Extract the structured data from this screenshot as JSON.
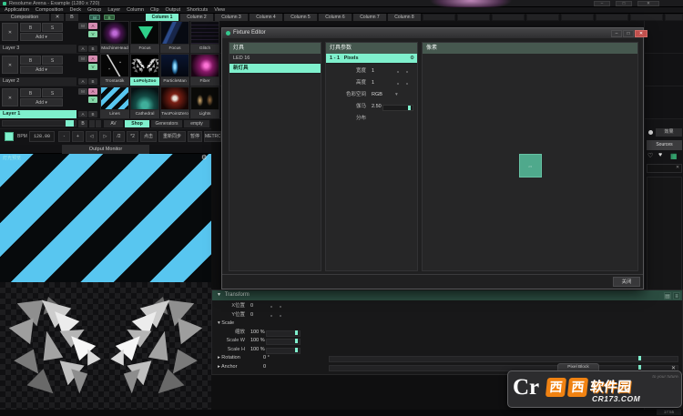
{
  "icons": {
    "caret_down": "▾",
    "arrow_right": "▸",
    "arrow_down": "▾",
    "gear": "⚙",
    "heart": "♥",
    "heart_outline": "♡",
    "grid": "▦",
    "dot": "·",
    "circle": "●",
    "panes": "▤",
    "list": "≡",
    "close": "✕",
    "minimize": "–",
    "maximize": "□"
  },
  "window": {
    "title": "Resolume Arena - Example (1280 x 720)"
  },
  "menu": {
    "items": [
      "Application",
      "Composition",
      "Deck",
      "Group",
      "Layer",
      "Column",
      "Clip",
      "Output",
      "Shortcuts",
      "View"
    ]
  },
  "column_bar": {
    "composition": "Composition",
    "bypass": "✕",
    "b": "B",
    "m": "M",
    "s": "S",
    "columns": [
      "Column 1",
      "Column 2",
      "Column 3",
      "Column 4",
      "Column 5",
      "Column 6",
      "Column 7",
      "Column 8"
    ]
  },
  "layer_controls": {
    "x": "✕",
    "bypass": "B",
    "solo": "S",
    "add": "Add",
    "m": "M",
    "a": "A",
    "v": "V",
    "ab_a": "A",
    "ab_b": "B"
  },
  "layers": [
    {
      "name": "Layer 3",
      "clips": [
        "MachineHead",
        "Focus",
        "Focus",
        "Glitch"
      ]
    },
    {
      "name": "Layer 2",
      "clips": [
        "Trontastik",
        "LoPolyZoo",
        "ParticleMan",
        "Fiber"
      ]
    },
    {
      "name": "Layer 1",
      "clips": [
        "Lines",
        "Cathedral",
        "TwoPointZero",
        "Lights"
      ]
    }
  ],
  "deck_bar": {
    "b": "B",
    "tabs": [
      "AV",
      "Shop",
      "Generators",
      "empty"
    ]
  },
  "bpm_bar": {
    "label": "BPM",
    "value": "128.00",
    "minus": "-",
    "plus": "+",
    "nudge_down": "◁",
    "nudge_up": "▷",
    "half": "/2",
    "double": "*2",
    "tap": "点击",
    "resync": "重新同步",
    "pause": "暂停",
    "metronome": "METRO"
  },
  "output_monitor": {
    "tab": "Output Monitor",
    "overlay": "灯光预览"
  },
  "fixture_editor": {
    "title": "Fixture Editor",
    "fixtures": {
      "header": "灯具",
      "items": [
        "LED 16",
        "新灯具"
      ]
    },
    "params": {
      "header": "灯具参数",
      "slot": "1 - 1",
      "slot_type": "Pixels",
      "width_label": "宽度",
      "width_value": "1",
      "height_label": "高度",
      "height_value": "1",
      "colorspace_label": "色彩空间",
      "colorspace_value": "RGB",
      "gamma_label": "伽马",
      "gamma_value": "2.50",
      "distribution_label": "分布"
    },
    "preview": {
      "header": "像素",
      "fixture_number": "1"
    },
    "close_button": "关闭"
  },
  "transform_panel": {
    "title": "Transform",
    "x_label": "X位置",
    "x_value": "0",
    "y_label": "Y位置",
    "y_value": "0",
    "scale_header": "Scale",
    "scale_label": "缩放",
    "scale_value": "100 %",
    "scale_w_label": "Scale W",
    "scale_w_value": "100 %",
    "scale_h_label": "Scale H",
    "scale_h_value": "100 %",
    "rotation_label": "Rotation",
    "rotation_value": "0 °",
    "anchor_label": "Anchor",
    "anchor_value": "0"
  },
  "right_panel": {
    "effects_tab": "效果",
    "sources_tab": "Sources"
  },
  "watermark": {
    "tab": "Pixel Block",
    "cr": "Cr",
    "xi1": "西",
    "xi2": "西",
    "name": "软件园",
    "site": "CR173.COM",
    "ghost": "to your future."
  },
  "status": {
    "clock": "17:55"
  },
  "colors": {
    "accent": "#7ff0cd",
    "stripe": "#58c6f0",
    "header_teal": "#46584f",
    "transform_header": "#2b4c40",
    "orange": "#f08212",
    "close_red": "#c0504d"
  }
}
